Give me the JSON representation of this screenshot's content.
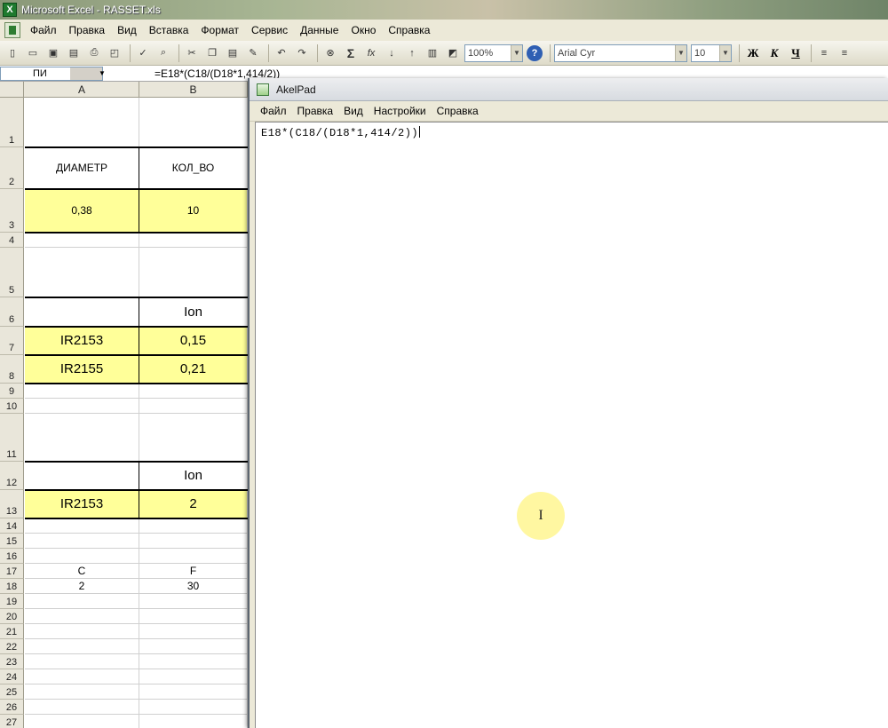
{
  "excel": {
    "title": "Microsoft Excel - RASSET.xls",
    "menu": [
      "Файл",
      "Правка",
      "Вид",
      "Вставка",
      "Формат",
      "Сервис",
      "Данные",
      "Окно",
      "Справка"
    ],
    "toolbar": {
      "zoom": "100%",
      "font": "Arial Cyr",
      "font_size": "10",
      "bold": "Ж",
      "italic": "К",
      "underline": "Ч"
    },
    "name_box": "ПИ",
    "formula": "=E18*(C18/(D18*1,414/2))",
    "columns": [
      "A",
      "B"
    ],
    "rows": [
      "1",
      "2",
      "3",
      "4",
      "5",
      "6",
      "7",
      "8",
      "9",
      "10",
      "11",
      "12",
      "13",
      "14",
      "15",
      "16",
      "17",
      "18",
      "19",
      "20",
      "21",
      "22",
      "23",
      "24",
      "25",
      "26",
      "27"
    ],
    "cells": {
      "a2": "ДИАМЕТР",
      "b2": "КОЛ_ВО",
      "a3": "0,38",
      "b3": "10",
      "b6": "Ion",
      "a7": "IR2153",
      "b7": "0,15",
      "a8": "IR2155",
      "b8": "0,21",
      "b12": "Ion",
      "a13": "IR2153",
      "b13": "2",
      "a17": "C",
      "b17": "F",
      "a18": "2",
      "b18": "30"
    }
  },
  "akelpad": {
    "title": "AkelPad",
    "menu": [
      "Файл",
      "Правка",
      "Вид",
      "Настройки",
      "Справка"
    ],
    "text": "E18*(C18/(D18*1,414/2))"
  }
}
